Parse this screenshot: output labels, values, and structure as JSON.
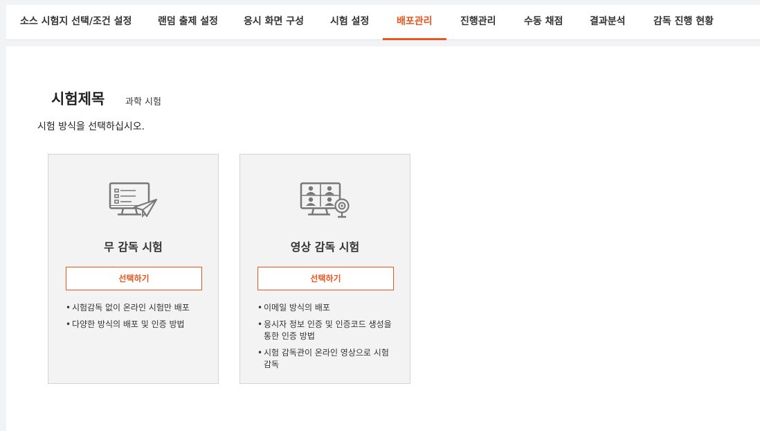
{
  "nav": {
    "tabs": [
      {
        "label": "소스 시험지 선택/조건 설정",
        "active": false
      },
      {
        "label": "랜덤 출제 설정",
        "active": false
      },
      {
        "label": "응시 화면 구성",
        "active": false
      },
      {
        "label": "시험 설정",
        "active": false
      },
      {
        "label": "배포관리",
        "active": true
      },
      {
        "label": "진행관리",
        "active": false
      },
      {
        "label": "수동 채점",
        "active": false
      },
      {
        "label": "결과분석",
        "active": false
      },
      {
        "label": "감독 진행 현황",
        "active": false
      }
    ],
    "accent_color": "#e8551f"
  },
  "page": {
    "title": "시험제목",
    "exam_name": "과학 시험",
    "instruction": "시험 방식을 선택하십시오."
  },
  "cards": [
    {
      "icon": "monitor-paper-plane-icon",
      "title": "무 감독 시험",
      "button": "선택하기",
      "features": [
        "시험감독 없이 온라인 시험만 배포",
        "다양한 방식의 배포 및 인증 방법"
      ]
    },
    {
      "icon": "video-conference-webcam-icon",
      "title": "영상 감독 시험",
      "button": "선택하기",
      "features": [
        "이메일 방식의 배포",
        "응시자 정보 인증 및 인증코드 생성을 통한 인증 방법",
        "시험 감독관이 온라인 영상으로 시험 감독"
      ]
    }
  ]
}
